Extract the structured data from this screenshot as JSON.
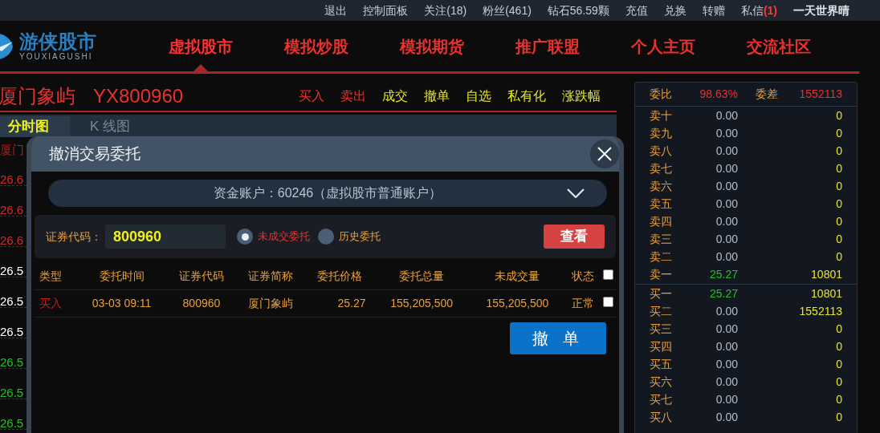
{
  "top_bar": {
    "links": [
      "退出",
      "控制面板",
      "关注(18)",
      "粉丝(461)",
      "钻石56.59颗",
      "充值",
      "兑换",
      "转赠"
    ],
    "messages": {
      "label": "私信",
      "count": "(1)"
    },
    "user": "一天世界晴"
  },
  "logo": {
    "name": "游侠股市",
    "subtitle": "YOUXIAGUSHI"
  },
  "nav": [
    {
      "label": "虚拟股市",
      "selected": true
    },
    {
      "label": "模拟炒股",
      "selected": false
    },
    {
      "label": "模拟期货",
      "selected": false
    },
    {
      "label": "推广联盟",
      "selected": false
    },
    {
      "label": "个人主页",
      "selected": false
    },
    {
      "label": "交流社区",
      "selected": false
    }
  ],
  "stock": {
    "name": "厦门象屿",
    "code": "YX800960"
  },
  "actions": [
    {
      "label": "买入",
      "color": "#e8322e"
    },
    {
      "label": "卖出",
      "color": "#e8322e"
    },
    {
      "label": "成交",
      "color": "#e6e62a"
    },
    {
      "label": "撤单",
      "color": "#e6e62a"
    },
    {
      "label": "自选",
      "color": "#e6e62a"
    },
    {
      "label": "私有化",
      "color": "#e6e62a"
    },
    {
      "label": "涨跌幅",
      "color": "#e6e62a"
    }
  ],
  "tabs": [
    {
      "label": "分时图",
      "selected": true
    },
    {
      "label": "K 线图",
      "selected": false
    }
  ],
  "price_axis": {
    "label": "厦门",
    "ticks": [
      {
        "label": "26.6",
        "color": "#d42a2a"
      },
      {
        "label": "26.6",
        "color": "#d42a2a"
      },
      {
        "label": "26.6",
        "color": "#d42a2a"
      },
      {
        "label": "26.5",
        "color": "#ffffff"
      },
      {
        "label": "26.5",
        "color": "#ffffff"
      },
      {
        "label": "26.5",
        "color": "#ffffff"
      },
      {
        "label": "26.5",
        "color": "#22c322"
      },
      {
        "label": "26.5",
        "color": "#22c322"
      },
      {
        "label": "26.5",
        "color": "#22c322"
      }
    ]
  },
  "dialog": {
    "title": "撤消交易委托",
    "account": "资金账户：60246（虚拟股市普通账户）",
    "code_label": "证券代码：",
    "code_value": "800960",
    "filters": [
      {
        "label": "未成交委托",
        "selected": true
      },
      {
        "label": "历史委托",
        "selected": false
      }
    ],
    "query_button": "查看",
    "columns": [
      "类型",
      "委托时间",
      "证券代码",
      "证券简称",
      "委托价格",
      "委托总量",
      "未成交量",
      "状态"
    ],
    "select_all": {
      "checked": false
    },
    "rows": [
      {
        "type": "买入",
        "time": "03-03 09:11",
        "code": "800960",
        "name": "厦门象屿",
        "price": "25.27",
        "total": "155,205,500",
        "unfilled": "155,205,500",
        "status": "正常",
        "checked": false
      }
    ],
    "cancel_button": "撤 单"
  },
  "order_book": {
    "ratio_label": "委比",
    "ratio": "98.63%",
    "diff_label": "委差",
    "diff": "1552113",
    "asks": [
      {
        "label": "卖十",
        "price": "0.00",
        "volume": "0",
        "color": "#b4bccb"
      },
      {
        "label": "卖九",
        "price": "0.00",
        "volume": "0",
        "color": "#b4bccb"
      },
      {
        "label": "卖八",
        "price": "0.00",
        "volume": "0",
        "color": "#b4bccb"
      },
      {
        "label": "卖七",
        "price": "0.00",
        "volume": "0",
        "color": "#b4bccb"
      },
      {
        "label": "卖六",
        "price": "0.00",
        "volume": "0",
        "color": "#b4bccb"
      },
      {
        "label": "卖五",
        "price": "0.00",
        "volume": "0",
        "color": "#b4bccb"
      },
      {
        "label": "卖四",
        "price": "0.00",
        "volume": "0",
        "color": "#b4bccb"
      },
      {
        "label": "卖三",
        "price": "0.00",
        "volume": "0",
        "color": "#b4bccb"
      },
      {
        "label": "卖二",
        "price": "0.00",
        "volume": "0",
        "color": "#b4bccb"
      },
      {
        "label": "卖一",
        "price": "25.27",
        "volume": "10801",
        "color": "#22c322"
      }
    ],
    "bids": [
      {
        "label": "买一",
        "price": "25.27",
        "volume": "10801",
        "color": "#22c322"
      },
      {
        "label": "买二",
        "price": "0.00",
        "volume": "1552113",
        "color": "#b4bccb"
      },
      {
        "label": "买三",
        "price": "0.00",
        "volume": "0",
        "color": "#b4bccb"
      },
      {
        "label": "买四",
        "price": "0.00",
        "volume": "0",
        "color": "#b4bccb"
      },
      {
        "label": "买五",
        "price": "0.00",
        "volume": "0",
        "color": "#b4bccb"
      },
      {
        "label": "买六",
        "price": "0.00",
        "volume": "0",
        "color": "#b4bccb"
      },
      {
        "label": "买七",
        "price": "0.00",
        "volume": "0",
        "color": "#b4bccb"
      },
      {
        "label": "买八",
        "price": "0.00",
        "volume": "0",
        "color": "#b4bccb"
      }
    ]
  }
}
